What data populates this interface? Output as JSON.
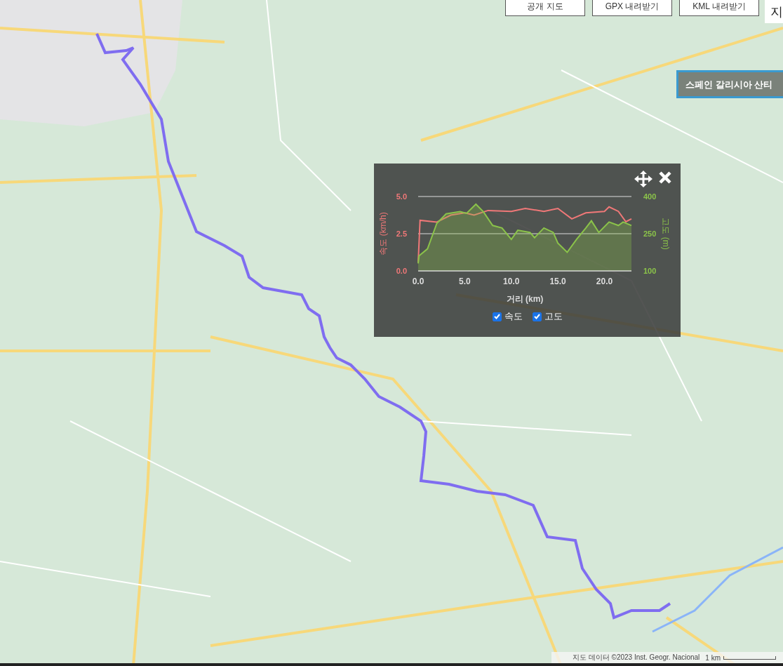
{
  "top_buttons": [
    {
      "label": "공개 지도"
    },
    {
      "label": "GPX 내려받기"
    },
    {
      "label": "KML 내려받기"
    }
  ],
  "map_type_button": {
    "label": "지"
  },
  "route_title": "스페인 갈리시아 산티",
  "chart_panel": {
    "legend": [
      {
        "checked": true
      },
      {
        "checked": true
      }
    ],
    "chart_data": {
      "type": "line",
      "xlabel": "거리 (km)",
      "ylabel": "속도 (km/h)",
      "y2label": "고도 (m)",
      "xlim": [
        0,
        22.9
      ],
      "ylim": [
        0,
        5
      ],
      "y2lim": [
        100,
        400
      ],
      "xticks": [
        {
          "value": 0,
          "label": "0.0"
        },
        {
          "value": 5,
          "label": "5.0"
        },
        {
          "value": 10,
          "label": "10.0"
        },
        {
          "value": 15,
          "label": "15.0"
        },
        {
          "value": 20,
          "label": "20.0"
        }
      ],
      "yticks": [
        {
          "value": 0,
          "label": "0.0"
        },
        {
          "value": 2.5,
          "label": "2.5"
        },
        {
          "value": 5,
          "label": "5.0"
        }
      ],
      "y2ticks": [
        100,
        250,
        400
      ],
      "series": [
        {
          "name": "속도",
          "color": "#f07878",
          "x": [
            0,
            0.2,
            2,
            3.5,
            5,
            6,
            7.5,
            10,
            11.5,
            13.5,
            15,
            16.5,
            18,
            20,
            20.5,
            21.5,
            22.3,
            22.9
          ],
          "values": [
            0.55,
            3.4,
            3.28,
            3.75,
            3.9,
            3.75,
            4.06,
            4.0,
            4.2,
            4.0,
            4.2,
            3.5,
            3.9,
            4.0,
            4.3,
            4.0,
            3.3,
            3.5
          ]
        },
        {
          "name": "고도",
          "color": "#8bc34a",
          "axis": "y2",
          "type": "area",
          "x": [
            0,
            0.1,
            1,
            2,
            3,
            4.5,
            5.2,
            6.2,
            7,
            8,
            9,
            10,
            10.7,
            12,
            12.5,
            13.5,
            14.5,
            15,
            16,
            17,
            18,
            18.6,
            19.4,
            20.5,
            21.5,
            22,
            22.9
          ],
          "values": [
            130,
            161,
            189,
            292,
            330,
            339,
            332,
            369,
            339,
            283,
            273,
            227,
            264,
            255,
            234,
            273,
            255,
            212,
            175,
            227,
            273,
            302,
            255,
            297,
            283,
            297,
            283
          ]
        }
      ]
    }
  },
  "attribution": "지도 데이터 ©2023 Inst. Geogr. Nacional",
  "scale_label": "1 km"
}
